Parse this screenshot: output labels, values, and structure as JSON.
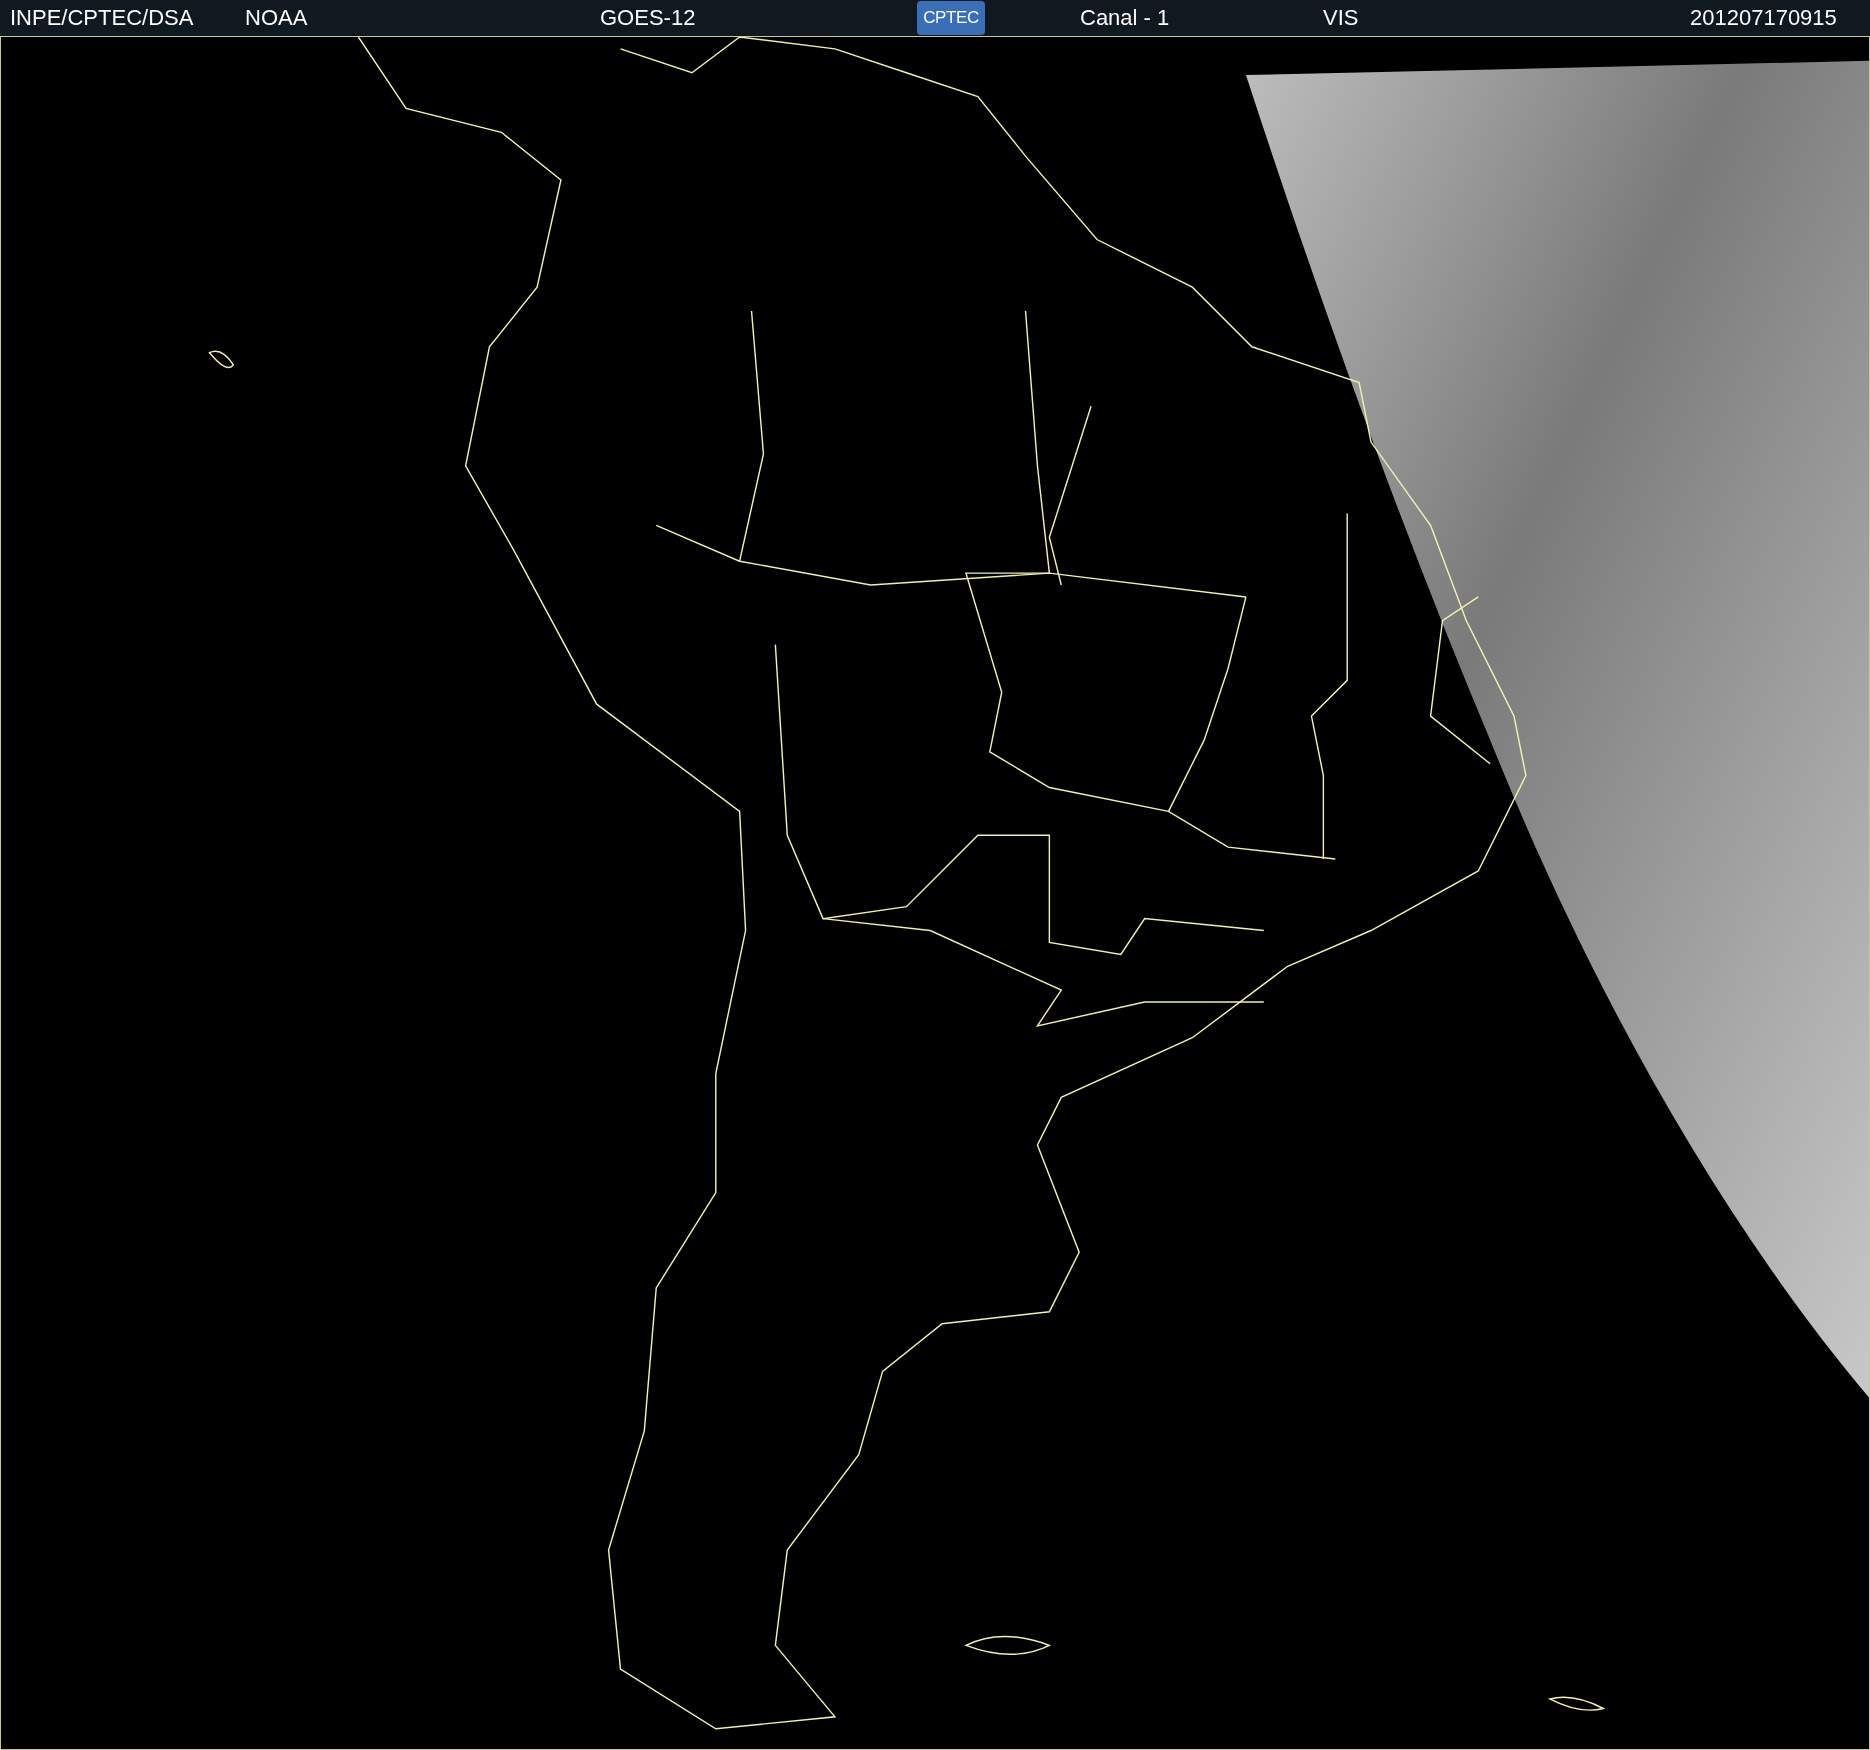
{
  "header": {
    "items": [
      {
        "kind": "text",
        "text": "INPE/CPTEC/DSA"
      },
      {
        "kind": "text",
        "text": "NOAA"
      },
      {
        "kind": "text",
        "text": "GOES-12"
      },
      {
        "kind": "logo",
        "text": "CPTEC"
      },
      {
        "kind": "text",
        "text": "Canal - 1"
      },
      {
        "kind": "text",
        "text": "VIS"
      },
      {
        "kind": "text",
        "text": "201207170915"
      }
    ]
  }
}
